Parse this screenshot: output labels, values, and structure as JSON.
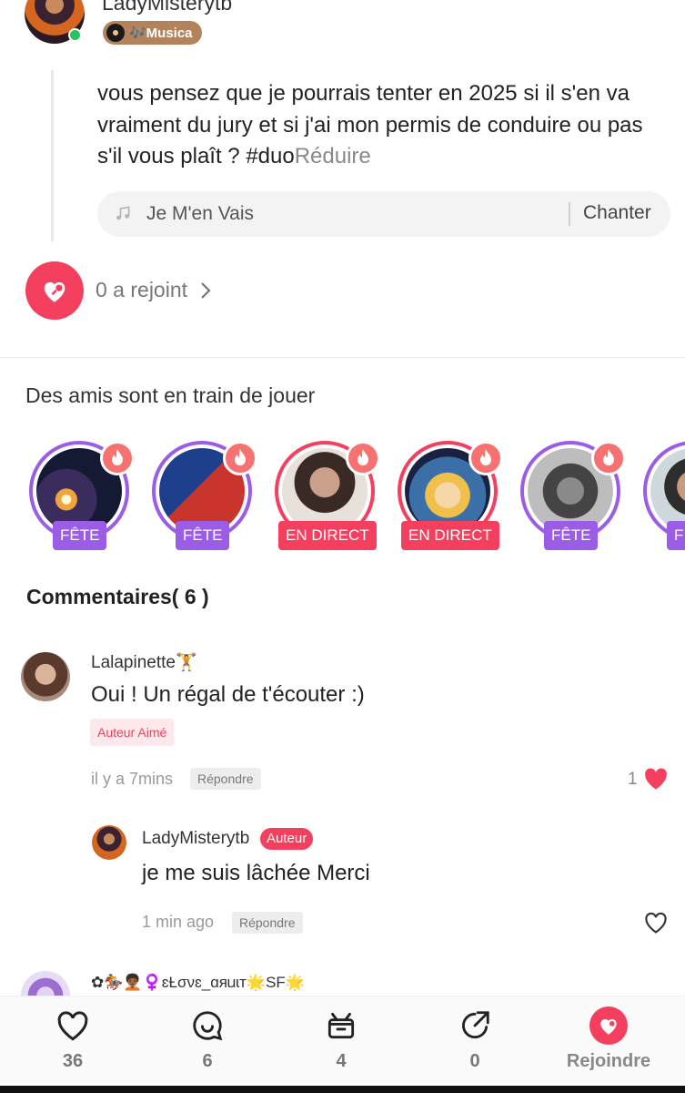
{
  "post": {
    "author_name": "LadyMisterytb",
    "genre_badge": "🎶Musica",
    "text_main": "vous pensez que je pourrais tenter en 2025 si il s'en va vraiment du jury et si j'ai mon permis de conduire ou pas s'il vous plaît ? #duo",
    "collapse_label": "Réduire",
    "song_title": "Je M'en Vais",
    "sing_label": "Chanter",
    "joined_label": "0 a rejoint"
  },
  "friends": {
    "title": "Des amis sont en train de jouer",
    "items": [
      {
        "tag": "FÊTE",
        "live": false
      },
      {
        "tag": "FÊTE",
        "live": false
      },
      {
        "tag": "EN DIRECT",
        "live": true
      },
      {
        "tag": "EN DIRECT",
        "live": true
      },
      {
        "tag": "FÊTE",
        "live": false
      },
      {
        "tag": "F",
        "live": false
      }
    ]
  },
  "comments": {
    "title": "Commentaires( 6 )",
    "items": [
      {
        "author": "Lalapinette🏋",
        "text": "Oui ! Un régal de t'écouter :)",
        "badge": "Auteur Aimé",
        "time": "il y a 7mins",
        "reply_label": "Répondre",
        "likes": "1",
        "liked": true
      },
      {
        "author": "LadyMisterytb",
        "badge": "Auteur",
        "text": "je me suis lâchée Merci",
        "time": "1 min ago",
        "reply_label": "Répondre",
        "liked": false
      },
      {
        "author": "✿🏇🧑🏾‍🦱♀️ɛȽσνɛ_ɑяɩɹɩт🌟SF🌟"
      }
    ]
  },
  "bottom_bar": {
    "likes": "36",
    "comments": "6",
    "gifts": "4",
    "shares": "0",
    "join": "Rejoindre"
  },
  "colors": {
    "accent": "#f43f5e",
    "party_tag": "#9b5de5",
    "online": "#22c55e",
    "genre_badge": "#b4835c"
  }
}
